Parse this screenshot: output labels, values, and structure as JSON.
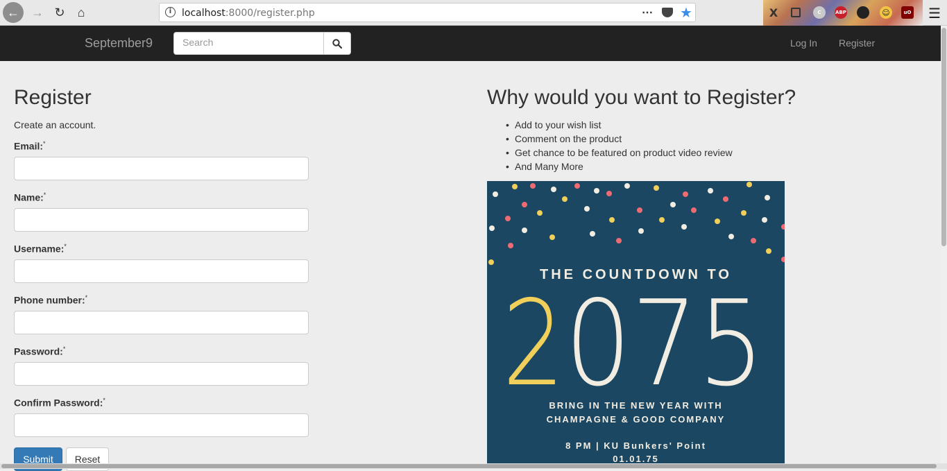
{
  "browser": {
    "url_host": "localhost",
    "url_path": ":8000/register.php",
    "extensions": [
      {
        "name": "abp-icon",
        "label": "ABP",
        "color": "#c8202a"
      },
      {
        "name": "ublock-icon",
        "label": "uO",
        "color": "#800000"
      }
    ]
  },
  "navbar": {
    "brand": "September9",
    "search_placeholder": "Search",
    "links": [
      "Log In",
      "Register"
    ]
  },
  "form": {
    "title": "Register",
    "subtitle": "Create an account.",
    "required_mark": "*",
    "fields": [
      {
        "label": "Email:"
      },
      {
        "label": "Name:"
      },
      {
        "label": "Username:"
      },
      {
        "label": "Phone number:"
      },
      {
        "label": "Password:"
      },
      {
        "label": "Confirm Password:"
      }
    ],
    "submit_label": "Submit",
    "reset_label": "Reset"
  },
  "why": {
    "title": "Why would you want to Register?",
    "items": [
      "Add to your wish list",
      "Comment on the product",
      "Get chance to be featured on product video review",
      "And Many More"
    ]
  },
  "poster": {
    "headline": "THE COUNTDOWN TO",
    "year_first_digit": "2",
    "year_rest": "075",
    "line1": "BRING IN THE NEW YEAR WITH",
    "line2": "CHAMPAGNE & GOOD COMPANY",
    "line3": "8 PM  |  KU Bunkers' Point",
    "line4": "01.01.75",
    "colors": {
      "background": "#1b4762",
      "accent_yellow": "#f0cf5a",
      "accent_pink": "#ef6b72",
      "cream": "#f2ede2"
    }
  }
}
